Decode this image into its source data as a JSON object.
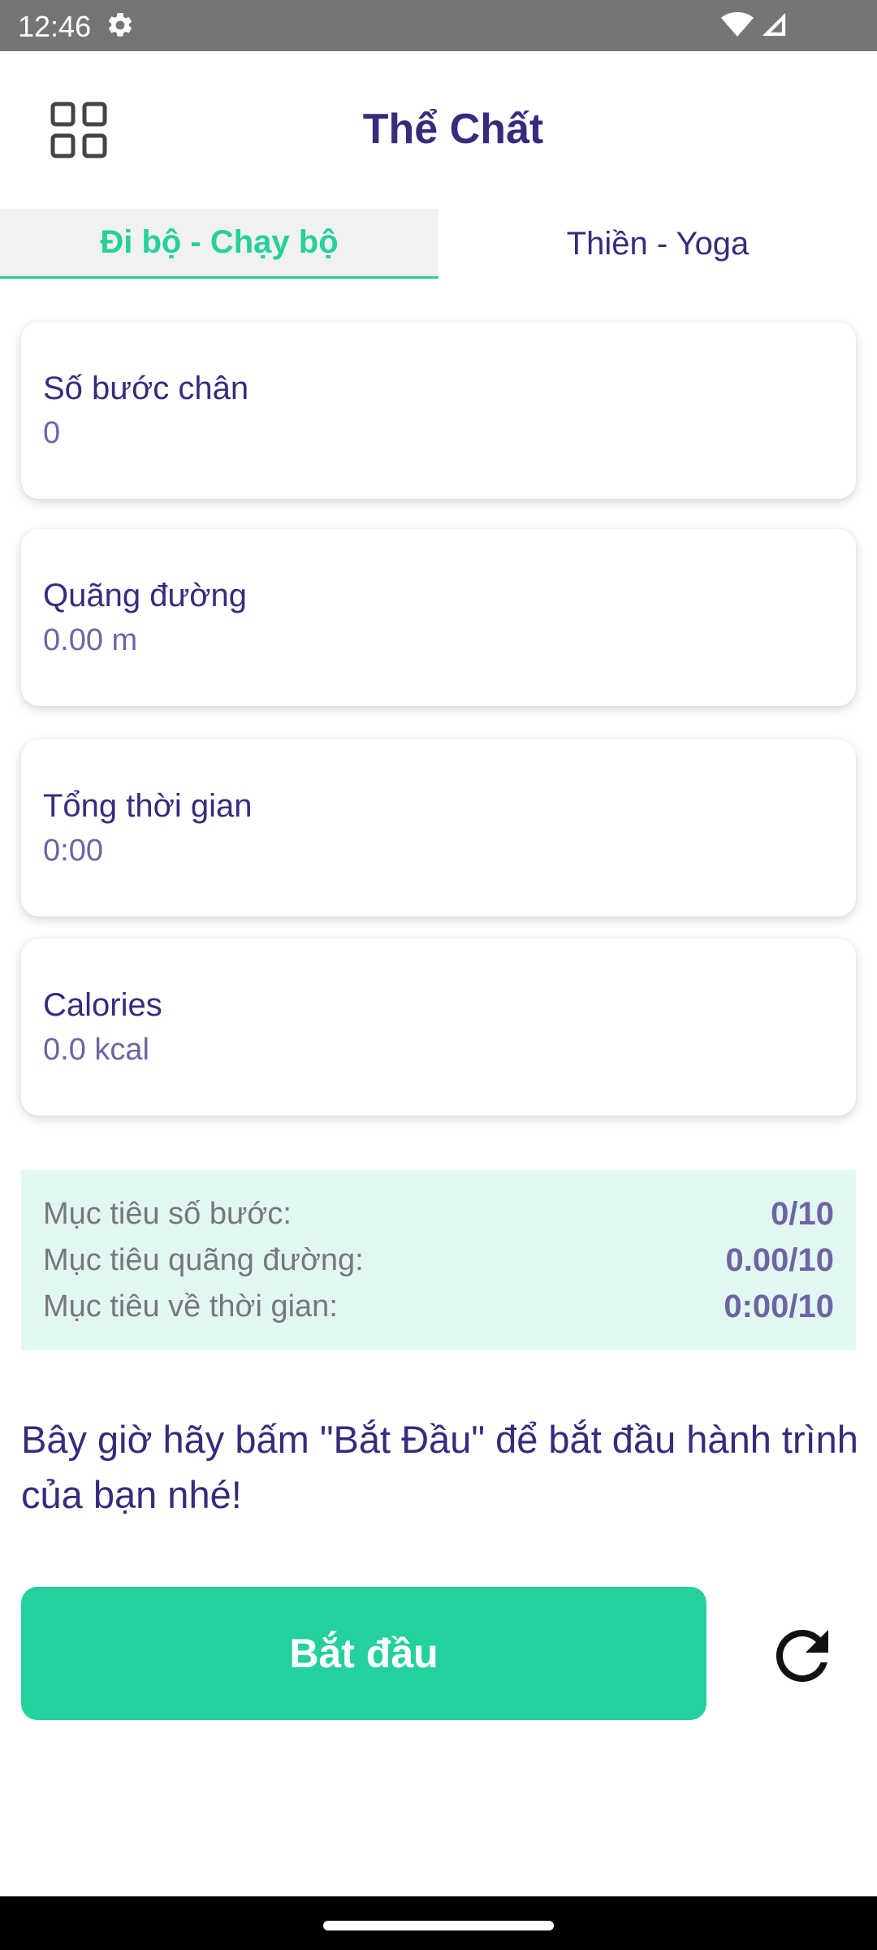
{
  "status_bar": {
    "time": "12:46",
    "icons": [
      "gear-icon",
      "wifi-icon",
      "signal-icon"
    ]
  },
  "header": {
    "menu_icon": "grid-icon",
    "title": "Thể Chất"
  },
  "tabs": [
    {
      "label": "Đi bộ - Chạy bộ",
      "active": true
    },
    {
      "label": "Thiền - Yoga",
      "active": false
    }
  ],
  "stats": [
    {
      "label": "Số bước chân",
      "value": "0"
    },
    {
      "label": "Quãng đường",
      "value": "0.00 m"
    },
    {
      "label": "Tổng thời gian",
      "value": "0:00"
    },
    {
      "label": "Calories",
      "value": "0.0 kcal"
    }
  ],
  "goals": [
    {
      "label": "Mục tiêu số bước:",
      "value": "0/10"
    },
    {
      "label": "Mục tiêu quãng đường:",
      "value": "0.00/10"
    },
    {
      "label": "Mục tiêu về thời gian:",
      "value": "0:00/10"
    }
  ],
  "prompt": "Bây giờ hãy bấm \"Bắt Đầu\" để bắt đầu hành trình của bạn nhé!",
  "actions": {
    "start_label": "Bắt đầu",
    "refresh_icon": "refresh-icon"
  },
  "colors": {
    "accent": "#24d09d",
    "primary_text": "#3a2a7d",
    "secondary_text": "#6f64a3",
    "goals_bg": "#e3f7f2",
    "status_bar": "#757575"
  }
}
